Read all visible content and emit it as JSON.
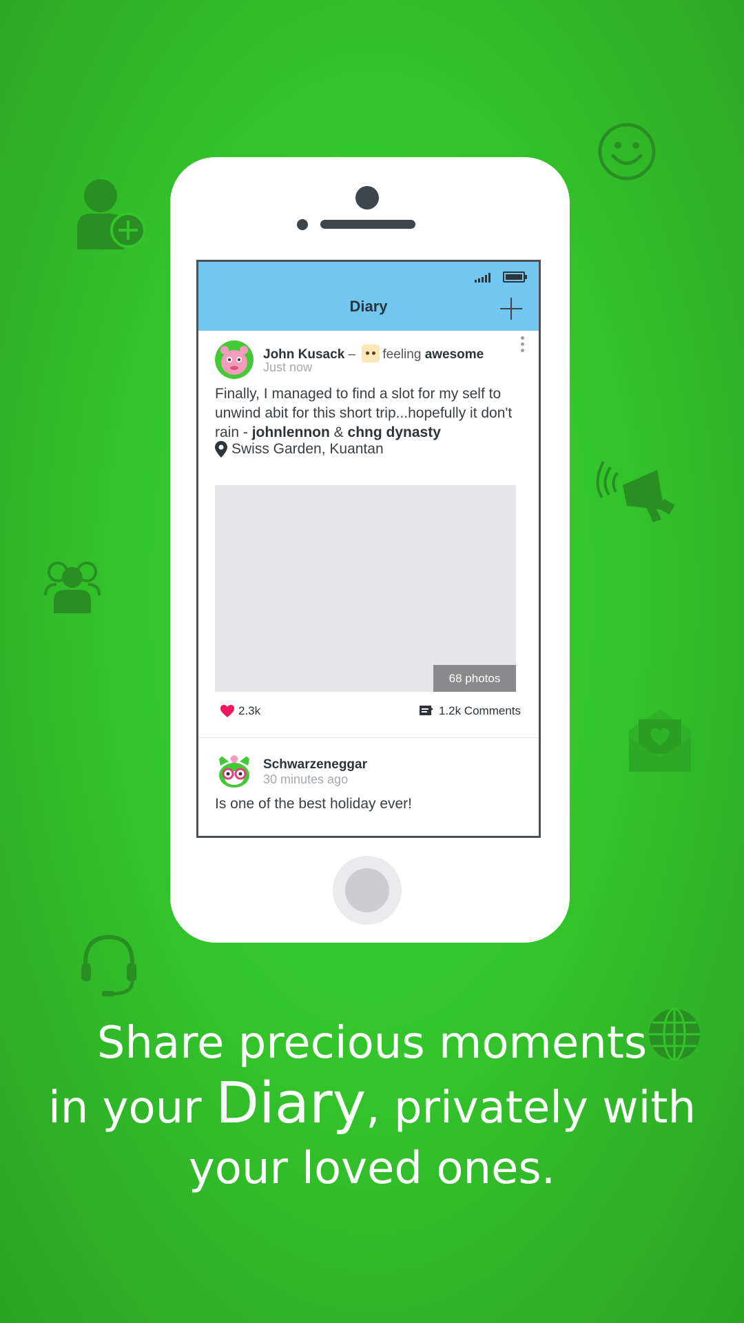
{
  "app": {
    "title": "Diary",
    "accent_color": "#72c6f0",
    "background_color": "#33c52b"
  },
  "posts": [
    {
      "author": "John Kusack",
      "separator": "–",
      "feeling_prefix": "feeling",
      "feeling": "awesome",
      "time": "Just now",
      "text_plain": "Finally, I managed to find a slot for my self to unwind abit for this short trip...hopefully it don't rain - ",
      "tag1": "johnlennon",
      "tag_joiner": " & ",
      "tag2": "chng dynasty",
      "location": "Swiss Garden, Kuantan",
      "photos_badge": "68 photos",
      "likes": "2.3k",
      "comments": "1.2k Comments"
    },
    {
      "author": "Schwarzeneggar",
      "time": "30 minutes ago",
      "text": "Is one of the best holiday ever!"
    }
  ],
  "tagline": {
    "line1": "Share precious moments",
    "line2_pre": "in your ",
    "line2_big": "Diary",
    "line2_post": ", privately with",
    "line3": "your loved ones."
  },
  "icons": [
    "add-user-icon",
    "smiley-icon",
    "group-icon",
    "megaphone-icon",
    "love-letter-icon",
    "headset-icon",
    "globe-icon",
    "signal-icon",
    "battery-icon",
    "plus-icon",
    "more-vertical-icon",
    "location-pin-icon",
    "heart-icon",
    "comment-icon"
  ]
}
